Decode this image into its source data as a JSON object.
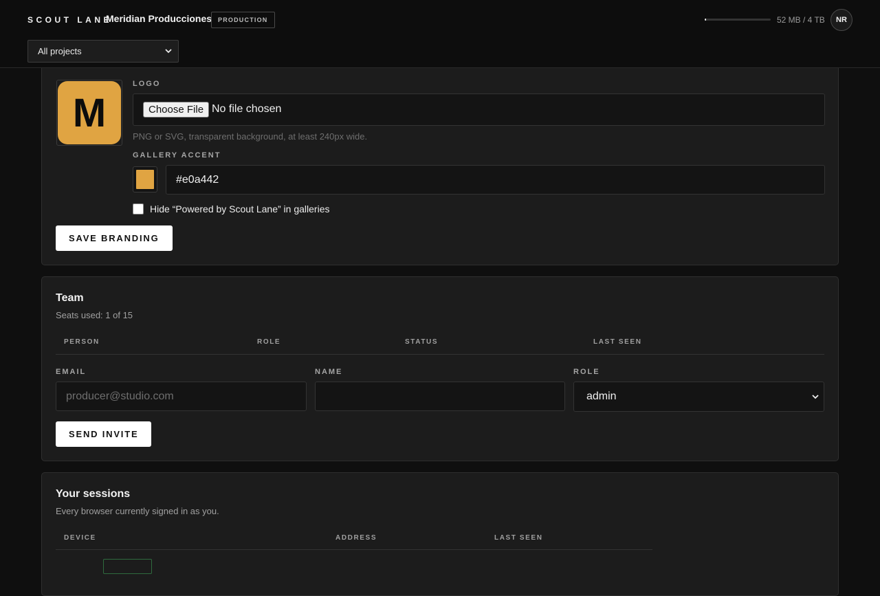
{
  "header": {
    "brand": "SCOUT LANE",
    "org_name": "Meridian Producciones",
    "role_badge": "PRODUCTION",
    "project_filter": "All projects",
    "storage": {
      "used_label": "52 MB / 4 TB",
      "fraction": 1.27e-05
    },
    "avatar_initials": "NR"
  },
  "branding": {
    "logo_label": "LOGO",
    "logo_letter": "M",
    "file_button": "Choose File",
    "file_status": "No file chosen",
    "file_hint": "PNG or SVG, transparent background, at least 240px wide.",
    "accent_label": "GALLERY ACCENT",
    "accent_value": "#e0a442",
    "hide_powered_label": "Hide “Powered by Scout Lane” in galleries",
    "hide_powered_checked": false,
    "save_button": "SAVE BRANDING"
  },
  "team": {
    "title": "Team",
    "seats": "Seats used: 1 of 15",
    "columns": [
      "PERSON",
      "ROLE",
      "STATUS",
      "LAST SEEN"
    ],
    "email_label": "EMAIL",
    "email_placeholder": "producer@studio.com",
    "name_label": "NAME",
    "name_value": "",
    "role_label": "ROLE",
    "role_value": "admin",
    "invite_button": "SEND INVITE"
  },
  "sessions": {
    "title": "Your sessions",
    "subtitle": "Every browser currently signed in as you.",
    "columns": [
      "DEVICE",
      "ADDRESS",
      "LAST SEEN"
    ]
  },
  "colors": {
    "accent": "#e0a442",
    "background": "#0f0f0f",
    "card": "#1c1c1c"
  }
}
